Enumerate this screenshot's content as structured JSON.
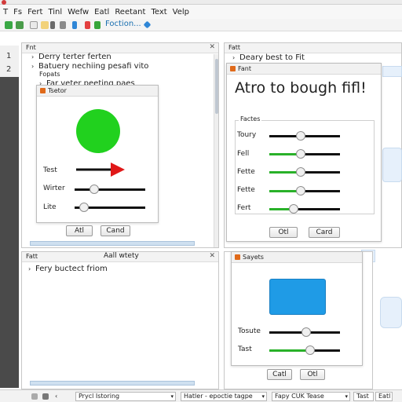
{
  "menu": [
    "T",
    "Fs",
    "Fert",
    "Tinl",
    "Wefw",
    "Eatl",
    "Reetant",
    "Text",
    "Velp"
  ],
  "toolbar": {
    "label": "Foction...",
    "icons": [
      "file-icon",
      "save-icon",
      "cut-icon",
      "copy-icon",
      "paste-icon",
      "undo-icon",
      "link-icon",
      "new-icon",
      "refresh-icon",
      "diamond-icon"
    ]
  },
  "gutter": {
    "lines": [
      "1",
      "2"
    ]
  },
  "left_top_panel": {
    "title": "Fnt",
    "tree": [
      "Derry terter ferten",
      "Batuery nechiing pesafi vito",
      "Fopats",
      "Far veter peeting paes"
    ]
  },
  "left_dialog": {
    "title": "Tsetor",
    "circle_color": "#21d11e",
    "arrow_color": "#e01818",
    "rows": [
      {
        "label": "Test"
      },
      {
        "label": "Wirter",
        "value": 0.28
      },
      {
        "label": "Lite",
        "value": 0.13
      }
    ],
    "buttons": [
      "Atl",
      "Cand"
    ]
  },
  "right_top_panel": {
    "title": "Fatt",
    "tree": [
      "Deary best to Fit"
    ]
  },
  "main_dialog": {
    "title": "Fant",
    "heading": "Atro to bough fifl!",
    "group_title": "Factes",
    "sliders": [
      {
        "label": "Toury",
        "value": 0.44,
        "fill": "#111111"
      },
      {
        "label": "Fell",
        "value": 0.44,
        "fill": "#29b129"
      },
      {
        "label": "Fette",
        "value": 0.44,
        "fill": "#29b129"
      },
      {
        "label": "Fette",
        "value": 0.44,
        "fill": "#29b129"
      },
      {
        "label": "Fert",
        "value": 0.35,
        "fill": "#29b129"
      }
    ],
    "buttons": [
      "Otl",
      "Card"
    ]
  },
  "left_bottom_panel": {
    "title": "Fatt",
    "subtitle": "Aall wtety",
    "tree": [
      "Fery buctect friom"
    ]
  },
  "bottom_right_dialog": {
    "title": "Sayets",
    "box_color": "#1f9be6",
    "rows": [
      {
        "label": "Tosute",
        "value": 0.52,
        "fill": "#111111"
      },
      {
        "label": "Tast",
        "value": 0.58,
        "fill": "#29b129"
      }
    ],
    "buttons": [
      "Catl",
      "Otl"
    ]
  },
  "statusbar": {
    "fields": [
      "Prycl Istoring",
      "Hatler - epoctie tagpe",
      "Fapy CUK Tease",
      "Tast",
      "Eatl"
    ]
  }
}
